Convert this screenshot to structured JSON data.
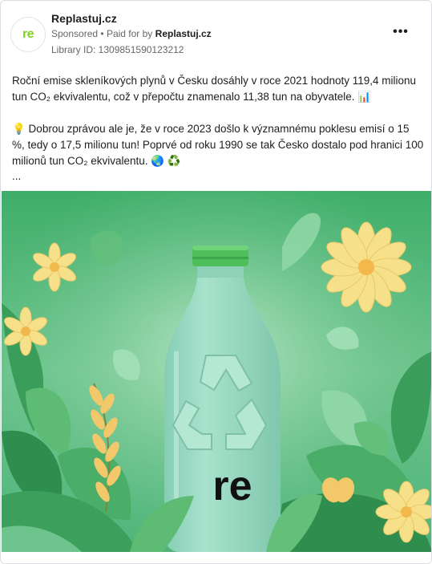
{
  "ad": {
    "page_name": "Replastuj.cz",
    "avatar_text": "re",
    "sponsored_label": "Sponsored",
    "paid_for_prefix": "Paid for by",
    "paid_for_by": "Replastuj.cz",
    "library_id": "Library ID: 1309851590123212",
    "more_icon": "more-horizontal-icon"
  },
  "post": {
    "paragraph_1": "Roční emise skleníkových plynů v Česku dosáhly v roce 2021 hodnoty 119,4 milionu tun CO₂ ekvivalentu, což v přepočtu znamenalo 11,38 tun na obyvatele. 📊",
    "paragraph_2": "💡 Dobrou zprávou ale je, že v roce 2023 došlo k významnému poklesu emisí o 15 %, tedy o 17,5 milionu tun! Poprvé od roku 1990 se tak Česko dostalo pod hranici 100 milionů tun CO₂ ekvivalentu. 🌏 ♻️",
    "see_more": "..."
  },
  "creative": {
    "bottle_logo": "re",
    "colors": {
      "background": "#6fc28a",
      "bottle": "#9fdcc4",
      "cap": "#4fbf5a",
      "flower": "#f7e08a"
    }
  }
}
